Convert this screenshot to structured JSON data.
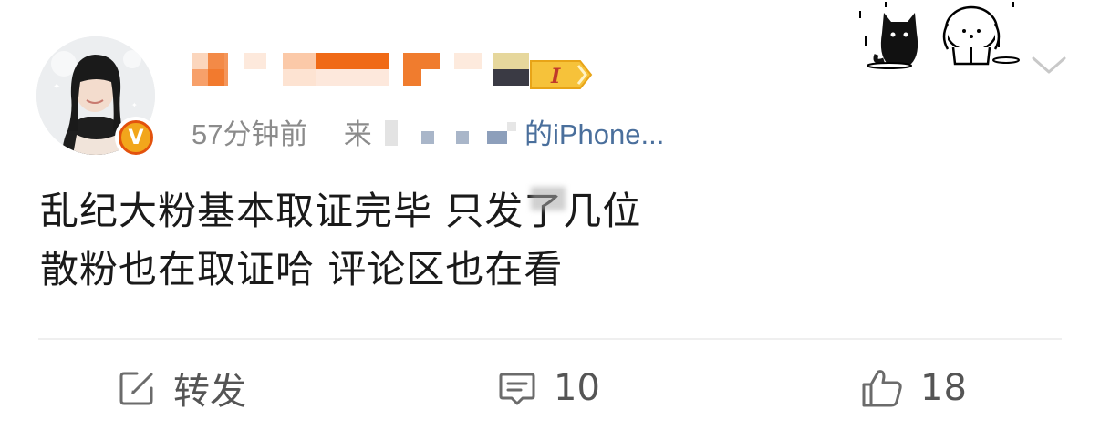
{
  "post": {
    "meta": {
      "time": "57分钟前",
      "source_prefix": "来",
      "source_device": "的iPhone..."
    },
    "text_lines": [
      "乱纪大粉基本取证完毕 只发了几位",
      "散粉也在取证哈 评论区也在看"
    ]
  },
  "actions": {
    "repost_label": "转发",
    "comment_count": "10",
    "like_count": "18"
  },
  "badges": {
    "verified_letter": "V",
    "vip_letter": "I"
  },
  "colors": {
    "meta_gray": "#8b8b8b",
    "source_blue": "#4a6f9c",
    "username_orange": "#f06a16",
    "verified_gold": "#f2a61c",
    "verified_ring": "#e3520d",
    "vip_gold": "#f6c23a"
  },
  "icons": {
    "repost": "edit-square-icon",
    "comment": "comment-bubble-icon",
    "like": "thumbs-up-icon",
    "more": "chevron-down-icon"
  }
}
